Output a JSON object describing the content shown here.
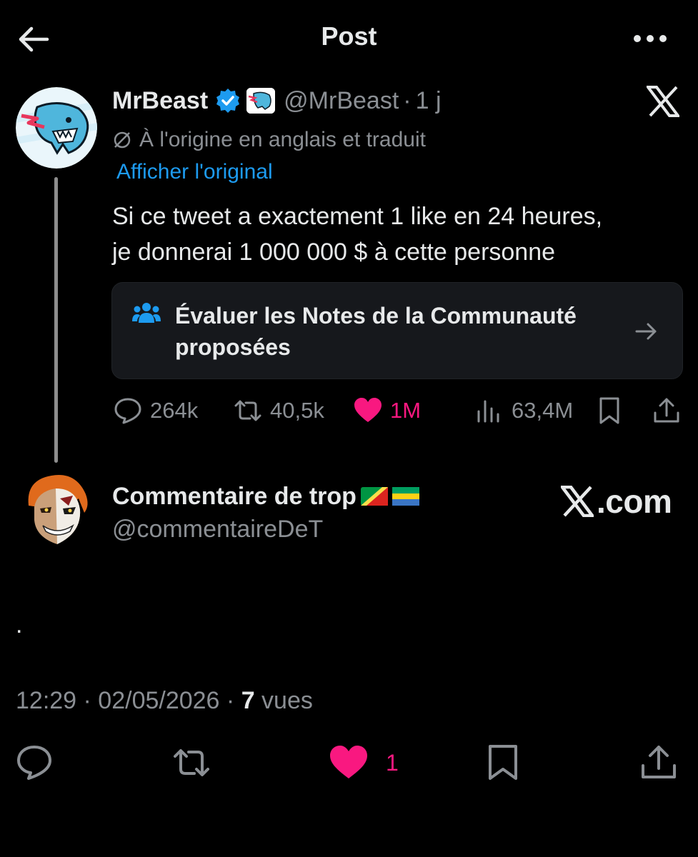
{
  "header": {
    "title": "Post"
  },
  "parent_tweet": {
    "display_name": "MrBeast",
    "handle": "@MrBeast",
    "separator": "·",
    "time": "1 j",
    "translated_label": "À l'origine en anglais et traduit",
    "show_original_label": "Afficher l'original",
    "text_lines": [
      "Si ce tweet a exactement 1 like en 24 heures,",
      "je donnerai 1 000 000 $ à cette personne"
    ],
    "community_notes_lines": [
      "Évaluer les Notes de la Communauté",
      "proposées"
    ],
    "actions": {
      "replies": "264k",
      "reposts": "40,5k",
      "likes": "1M",
      "views": "63,4M"
    }
  },
  "reply_tweet": {
    "display_name": "Commentaire de trop",
    "handle": "@commentaireDeT",
    "watermark": ".com",
    "text": ".",
    "timestamp": "12:29 · 02/05/2026 · ",
    "views_count": "7",
    "views_label": " vues",
    "like_count": "1"
  },
  "icons": {
    "back": "back-arrow-icon",
    "more": "more-icon",
    "verified": "verified-badge-icon",
    "reply": "reply-icon",
    "repost": "repost-icon",
    "like": "heart-icon",
    "views": "views-icon",
    "bookmark": "bookmark-icon",
    "share": "share-icon"
  },
  "colors": {
    "background": "#000000",
    "text": "#e7e9ea",
    "muted": "#8b8f94",
    "link": "#1d9bf0",
    "like": "#f91880",
    "verified": "#1d9bf0"
  }
}
